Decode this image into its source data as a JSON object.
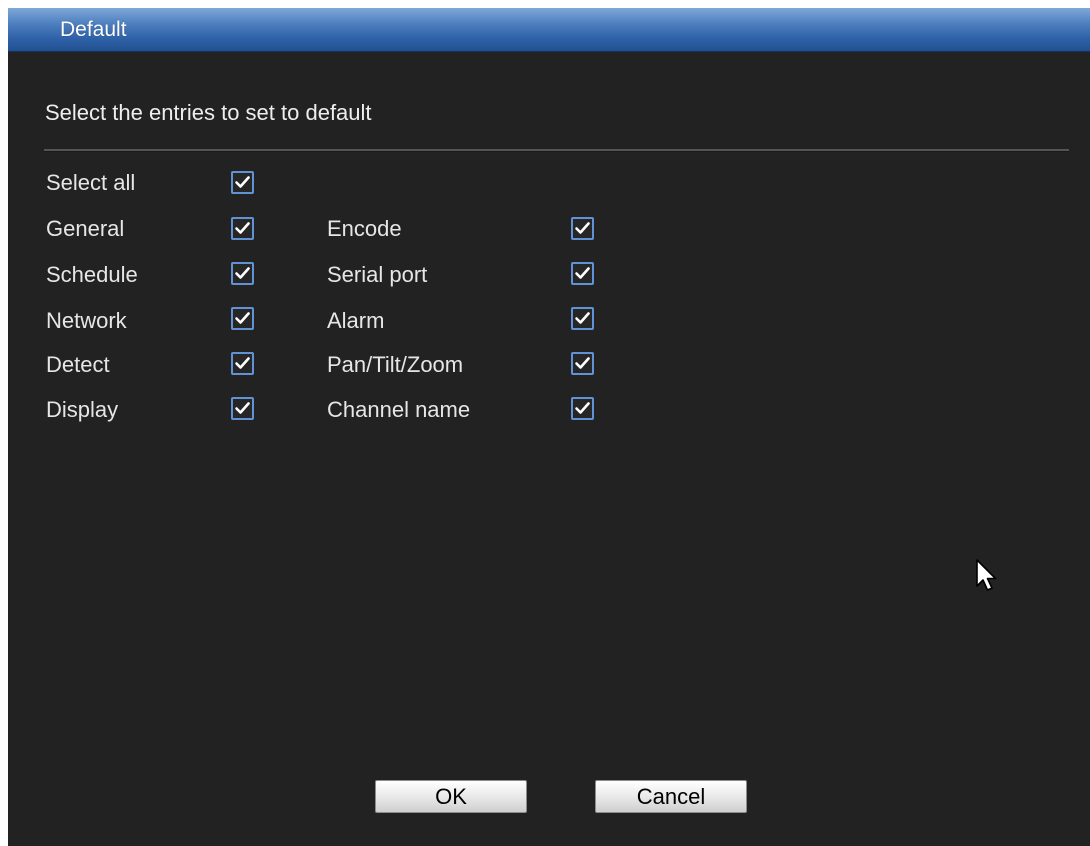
{
  "dialog": {
    "title": "Default",
    "instruction": "Select the entries to set to default",
    "select_all": {
      "label": "Select all",
      "checked": true
    },
    "left_column": [
      {
        "label": "General",
        "checked": true
      },
      {
        "label": "Schedule",
        "checked": true
      },
      {
        "label": "Network",
        "checked": true
      },
      {
        "label": "Detect",
        "checked": true
      },
      {
        "label": "Display",
        "checked": true
      }
    ],
    "right_column": [
      {
        "label": "Encode",
        "checked": true
      },
      {
        "label": "Serial port",
        "checked": true
      },
      {
        "label": "Alarm",
        "checked": true
      },
      {
        "label": "Pan/Tilt/Zoom",
        "checked": true
      },
      {
        "label": "Channel name",
        "checked": true
      }
    ],
    "buttons": {
      "ok_label": "OK",
      "cancel_label": "Cancel"
    }
  },
  "icons": {
    "checkbox_check": "check-icon",
    "pointer": "mouse-cursor-icon"
  },
  "colors": {
    "background": "#222222",
    "titlebar": "#3a6cb0",
    "checkbox_border": "#5f93d6",
    "text": "#e6e6e6"
  }
}
